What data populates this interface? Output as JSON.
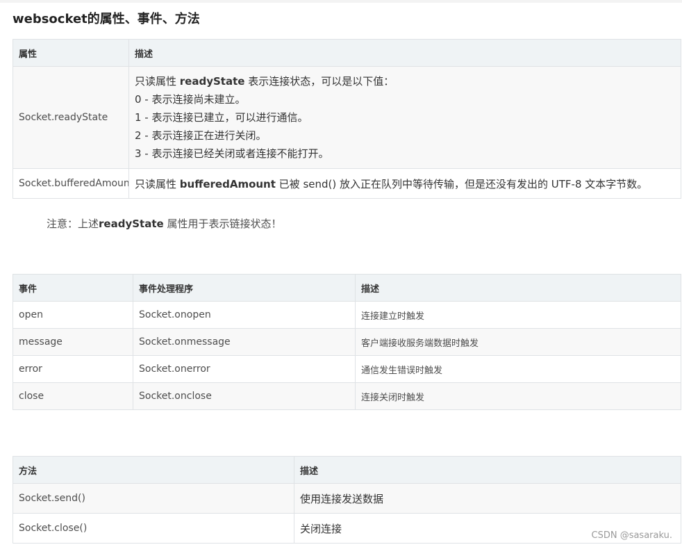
{
  "heading": "websocket的属性、事件、方法",
  "properties": {
    "headers": [
      "属性",
      "描述"
    ],
    "rows": [
      {
        "name": "Socket.readyState",
        "intro_a": "只读属性 ",
        "intro_bold": "readyState",
        "intro_b": " 表示连接状态，可以是以下值：",
        "values": [
          "0 - 表示连接尚未建立。",
          "1 - 表示连接已建立，可以进行通信。",
          "2 - 表示连接正在进行关闭。",
          "3 - 表示连接已经关闭或者连接不能打开。"
        ]
      },
      {
        "name": "Socket.bufferedAmount",
        "desc_a": "只读属性 ",
        "desc_bold": "bufferedAmount",
        "desc_b": " 已被 send() 放入正在队列中等待传输，但是还没有发出的 UTF-8 文本字节数。"
      }
    ]
  },
  "note": {
    "prefix": "注意：上述",
    "bold": "readyState",
    "suffix": " 属性用于表示链接状态！"
  },
  "events": {
    "headers": [
      "事件",
      "事件处理程序",
      "描述"
    ],
    "rows": [
      [
        "open",
        "Socket.onopen",
        "连接建立时触发"
      ],
      [
        "message",
        "Socket.onmessage",
        "客户端接收服务端数据时触发"
      ],
      [
        "error",
        "Socket.onerror",
        "通信发生错误时触发"
      ],
      [
        "close",
        "Socket.onclose",
        "连接关闭时触发"
      ]
    ]
  },
  "methods": {
    "headers": [
      "方法",
      "描述"
    ],
    "rows": [
      [
        "Socket.send()",
        "使用连接发送数据"
      ],
      [
        "Socket.close()",
        "关闭连接"
      ]
    ]
  },
  "watermark": "CSDN @sasaraku."
}
